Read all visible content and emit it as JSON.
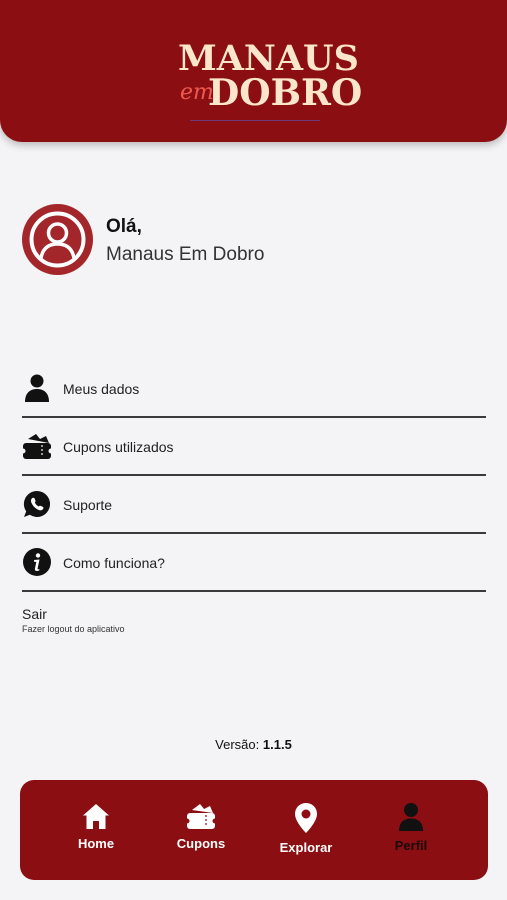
{
  "header": {
    "logo_line1": "MANAUS",
    "logo_em": "em",
    "logo_line2": "DOBRO"
  },
  "profile": {
    "greeting": "Olá,",
    "name": "Manaus Em Dobro",
    "avatar_icon": "user-circle-icon"
  },
  "menu": {
    "items": [
      {
        "label": "Meus dados",
        "icon": "user-icon"
      },
      {
        "label": "Cupons utilizados",
        "icon": "coupons-icon"
      },
      {
        "label": "Suporte",
        "icon": "whatsapp-icon"
      },
      {
        "label": "Como funciona?",
        "icon": "info-icon"
      }
    ],
    "logout_title": "Sair",
    "logout_subtitle": "Fazer logout do aplicativo"
  },
  "version": {
    "label": "Versão:",
    "number": "1.1.5"
  },
  "bottom_nav": {
    "items": [
      {
        "label": "Home",
        "icon": "home-icon"
      },
      {
        "label": "Cupons",
        "icon": "coupons-icon"
      },
      {
        "label": "Explorar",
        "icon": "map-pin-icon"
      },
      {
        "label": "Perfil",
        "icon": "user-icon",
        "active": true
      }
    ]
  },
  "colors": {
    "brand": "#8b0f12",
    "avatar": "#a3262a",
    "logo_text": "#fbe6cc",
    "logo_accent": "#ef5a50",
    "background": "#f4f4f6"
  }
}
